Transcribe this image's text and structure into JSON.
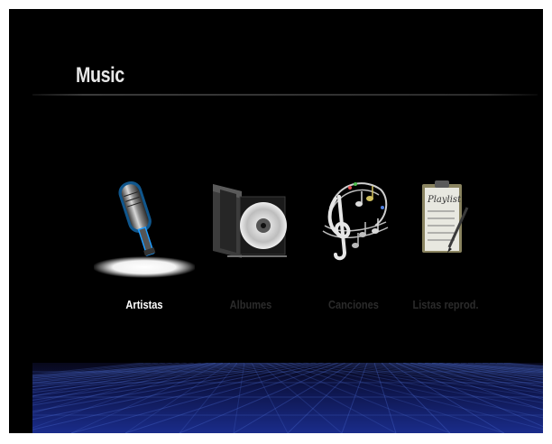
{
  "header": {
    "title": "Music"
  },
  "menu": {
    "selected_index": 0,
    "items": [
      {
        "label": "Artistas",
        "icon": "microphone-icon",
        "selected": true
      },
      {
        "label": "Albumes",
        "icon": "cd-case-icon",
        "selected": false
      },
      {
        "label": "Canciones",
        "icon": "music-notes-icon",
        "selected": false
      },
      {
        "label": "Listas reprod.",
        "icon": "playlist-clipboard-icon",
        "selected": false
      }
    ]
  },
  "colors": {
    "background": "#000000",
    "title": "#e8e8e8",
    "selected_label": "#ffffff",
    "unselected_label": "#2b2b2b",
    "selection_glow": "#1e9cff",
    "floor": "#1a2c8a"
  }
}
